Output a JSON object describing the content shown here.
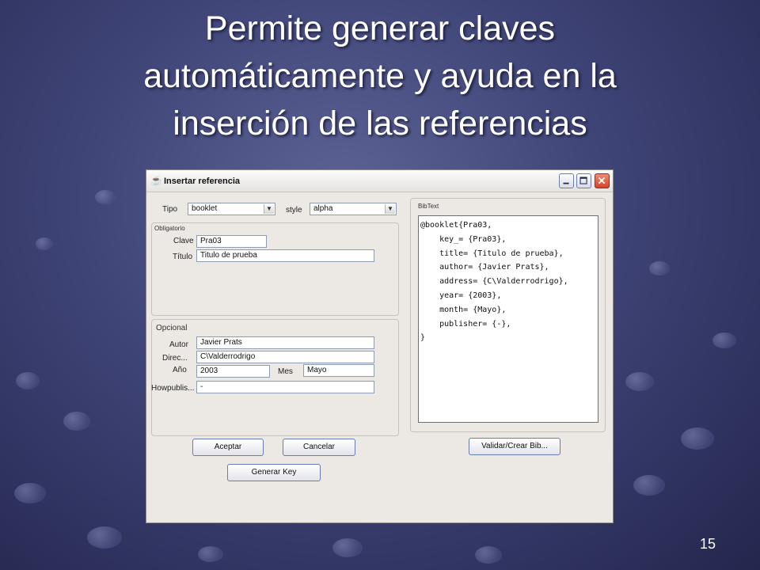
{
  "slide": {
    "title_lines": [
      "Permite generar claves",
      "automáticamente y ayuda en la",
      "inserción de las referencias"
    ],
    "page_number": "15"
  },
  "window": {
    "title": "Insertar referencia",
    "tipo_label": "Tipo",
    "tipo_value": "booklet",
    "style_label": "style",
    "style_value": "alpha",
    "obligatorio": {
      "title": "Obligatorio",
      "clave_label": "Clave",
      "clave_value": "Pra03",
      "titulo_label": "Título",
      "titulo_value": "Titulo de prueba"
    },
    "opcional": {
      "title": "Opcional",
      "autor_label": "Autor",
      "autor_value": "Javier Prats",
      "direc_label": "Direc...",
      "direc_value": "C\\Valderrodrigo",
      "anio_label": "Año",
      "anio_value": "2003",
      "mes_label": "Mes",
      "mes_value": "Mayo",
      "howpublis_label": "Howpublis...",
      "howpublis_value": "-"
    },
    "bibtext": {
      "title": "BibText",
      "lines": [
        "@booklet{Pra03,",
        "    key_= {Pra03},",
        "    title= {Titulo de prueba},",
        "    author= {Javier Prats},",
        "    address= {C\\Valderrodrigo},",
        "    year= {2003},",
        "    month= {Mayo},",
        "    publisher= {-},",
        "}"
      ]
    },
    "buttons": {
      "aceptar": "Aceptar",
      "cancelar": "Cancelar",
      "generar_key": "Generar Key",
      "validar": "Validar/Crear Bib..."
    }
  }
}
